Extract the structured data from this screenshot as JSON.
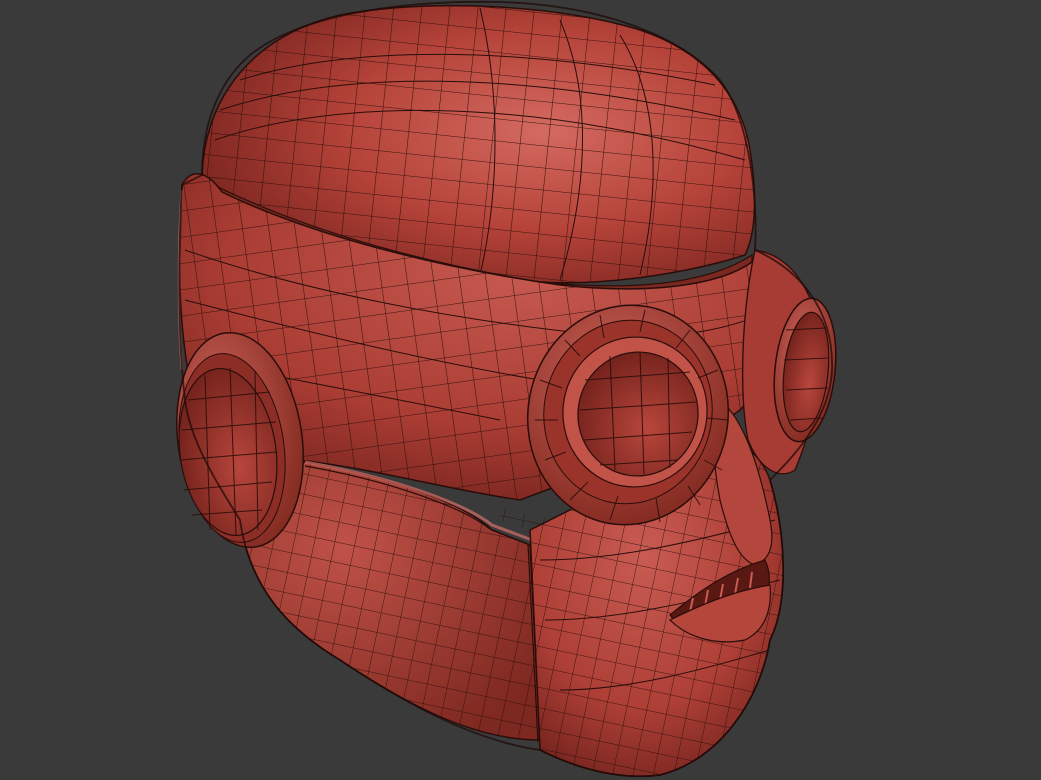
{
  "viewport": {
    "background": "#3a3a3a"
  },
  "model": {
    "subject": "robot-helmet-head",
    "material_color": "#b8443a",
    "highlight_color": "#d86a60",
    "shadow_color": "#6a1e18",
    "wire_color": "#2a0d0a",
    "display": "shaded-wireframe"
  }
}
